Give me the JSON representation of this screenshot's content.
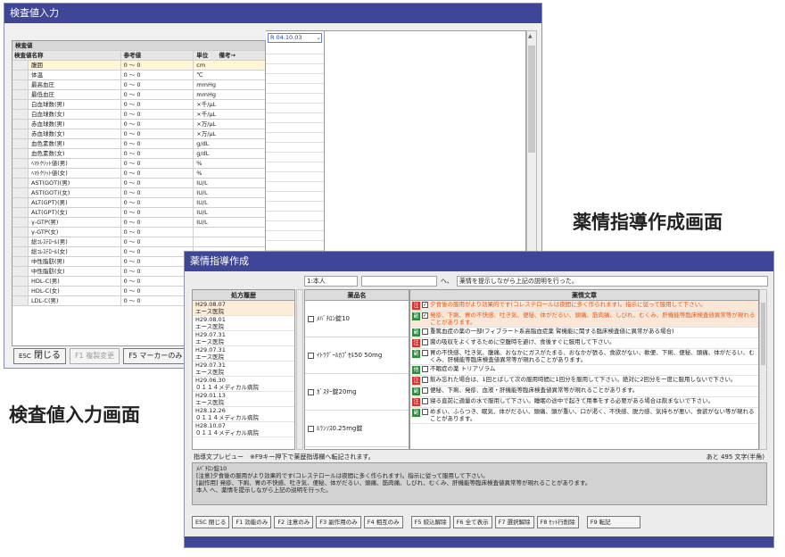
{
  "captions": {
    "lab_screen": "検査値入力画面",
    "guidance_screen": "薬情指導作成画面"
  },
  "lab_window": {
    "title": "検査値入力",
    "group_header": "検査値",
    "date_value": "R 04.10.03",
    "columns": {
      "name": "検査値名称",
      "ref": "参考値",
      "unit": "単位",
      "note": "備考→"
    },
    "rows": [
      {
        "name": "腹囲",
        "ref": "0 ～ 0",
        "unit": "cm"
      },
      {
        "name": "体温",
        "ref": "0 ～ 0",
        "unit": "℃"
      },
      {
        "name": "最高血圧",
        "ref": "0 ～ 0",
        "unit": "mmHg"
      },
      {
        "name": "最低血圧",
        "ref": "0 ～ 0",
        "unit": "mmHg"
      },
      {
        "name": "白血球数(男)",
        "ref": "0 ～ 0",
        "unit": "×千/μL"
      },
      {
        "name": "白血球数(女)",
        "ref": "0 ～ 0",
        "unit": "×千/μL"
      },
      {
        "name": "赤血球数(男)",
        "ref": "0 ～ 0",
        "unit": "×万/μL"
      },
      {
        "name": "赤血球数(女)",
        "ref": "0 ～ 0",
        "unit": "×万/μL"
      },
      {
        "name": "血色素数(男)",
        "ref": "0 ～ 0",
        "unit": "g/dL"
      },
      {
        "name": "血色素数(女)",
        "ref": "0 ～ 0",
        "unit": "g/dL"
      },
      {
        "name": "ﾍﾏﾄｸﾘｯﾄ値(男)",
        "ref": "0 ～ 0",
        "unit": "%"
      },
      {
        "name": "ﾍﾏﾄｸﾘｯﾄ値(女)",
        "ref": "0 ～ 0",
        "unit": "%"
      },
      {
        "name": "AST(GOT)(男)",
        "ref": "0 ～ 0",
        "unit": "IU/L"
      },
      {
        "name": "AST(GOT)(女)",
        "ref": "0 ～ 0",
        "unit": "IU/L"
      },
      {
        "name": "ALT(GPT)(男)",
        "ref": "0 ～ 0",
        "unit": "IU/L"
      },
      {
        "name": "ALT(GPT)(女)",
        "ref": "0 ～ 0",
        "unit": "IU/L"
      },
      {
        "name": "γ-GTP(男)",
        "ref": "0 ～ 0",
        "unit": "IU/L"
      },
      {
        "name": "γ-GTP(女)",
        "ref": "0 ～ 0",
        "unit": ""
      },
      {
        "name": "総ｺﾚｽﾃﾛｰﾙ(男)",
        "ref": "0 ～ 0",
        "unit": ""
      },
      {
        "name": "総ｺﾚｽﾃﾛｰﾙ(女)",
        "ref": "0 ～ 0",
        "unit": ""
      },
      {
        "name": "中性脂肪(男)",
        "ref": "0 ～ 0",
        "unit": ""
      },
      {
        "name": "中性脂肪(女)",
        "ref": "0 ～ 0",
        "unit": ""
      },
      {
        "name": "HDL-C(男)",
        "ref": "0 ～ 0",
        "unit": ""
      },
      {
        "name": "HDL-C(女)",
        "ref": "0 ～ 0",
        "unit": ""
      },
      {
        "name": "LDL-C(男)",
        "ref": "0 ～ 0",
        "unit": ""
      }
    ],
    "buttons": {
      "close": "閉じる",
      "close_key": "ESC",
      "f1": "F1 複製変更",
      "f5": "F5 マーカーのみ"
    }
  },
  "guidance_window": {
    "title": "薬情指導作成",
    "recipient": "1:本人",
    "to_suffix": "へ、",
    "sentence": "薬情を提示しながら上記の説明を行った。",
    "headers": {
      "history": "処方履歴",
      "drug": "薬品名",
      "message": "薬情文章"
    },
    "history": [
      {
        "date": "H29.08.07",
        "place": "エース医院"
      },
      {
        "date": "H29.08.01",
        "place": "エース医院"
      },
      {
        "date": "H29.07.31",
        "place": "エース医院"
      },
      {
        "date": "H29.07.31",
        "place": "エース医院"
      },
      {
        "date": "H29.07.31",
        "place": "エース医院"
      },
      {
        "date": "H29.06.30",
        "place": "０１１４メディカル病院"
      },
      {
        "date": "H29.01.13",
        "place": "エース医院"
      },
      {
        "date": "H28.12.26",
        "place": "０１１４メディカル病院"
      },
      {
        "date": "H28.10.07",
        "place": "０１１４メディカル病院"
      }
    ],
    "drugs": [
      {
        "name": "ﾒﾊﾞﾁﾛﾝ錠10"
      },
      {
        "name": "ｲﾄﾗｸﾞｰﾙｶﾌﾟｾﾙ50 50mg"
      },
      {
        "name": "ｶﾞｽﾀｰ錠20mg"
      },
      {
        "name": "ﾙﾗﾝｿｽ0.25mg錠"
      }
    ],
    "messages": [
      {
        "tag": "注",
        "tag_color": "#d9342b",
        "checked": true,
        "red": true,
        "text": "夕食後の服用がより効果的です(コレステロールは夜間に多く作られます)。指示に従って服用して下さい。"
      },
      {
        "tag": "副",
        "tag_color": "#2e8b3a",
        "checked": true,
        "red": true,
        "text": "発疹、下痢、胃の不快感、吐き気、便秘、体がだるい、頭痛、筋肉痛、しびれ、むくみ、肝機能等臨床検査値異常等が現れることがあります。"
      },
      {
        "tag": "副",
        "tag_color": "#2e8b3a",
        "checked": false,
        "red": false,
        "text": "重篤血症の薬の一部(フィブラート系高脂血症薬 腎機能に関する臨床検査値に異常がある場合)"
      },
      {
        "tag": "注",
        "tag_color": "#d9342b",
        "checked": false,
        "red": false,
        "text": "菌の吸収をよくするために空腹時を避け、食後すぐに服用して下さい。"
      },
      {
        "tag": "副",
        "tag_color": "#2e8b3a",
        "checked": false,
        "red": false,
        "text": "胃の不快感、吐き気、腹痛、おなかにガスがたまる、おなかが張る、食欲がない、軟便、下痢、便秘、頭痛、体がだるい、むくみ、肝機能等臨床検査値異常等が現れることがあります。"
      },
      {
        "tag": "他",
        "tag_color": "#2e8b3a",
        "checked": false,
        "red": false,
        "text": "不眠症の薬 トリアゾラム"
      },
      {
        "tag": "注",
        "tag_color": "#d9342b",
        "checked": false,
        "red": false,
        "text": "飲み忘れた場合は、1回とばして次の服用時間に1回分を服用して下さい。絶対に2回分を一度に服用しないで下さい。"
      },
      {
        "tag": "副",
        "tag_color": "#2e8b3a",
        "checked": false,
        "red": false,
        "text": "便秘、下痢、発疹、血液・肝機能等臨床検査値異常等が現れることがあります。"
      },
      {
        "tag": "注",
        "tag_color": "#d9342b",
        "checked": false,
        "red": false,
        "text": "寝る直前に適量の水で服用して下さい。睡眠の途中で起きて用事をする必要がある場合は飲まないで下さい。"
      },
      {
        "tag": "副",
        "tag_color": "#2e8b3a",
        "checked": false,
        "red": false,
        "text": "めまい、ふらつき、眠気、体がだるい、頭痛、頭が重い、口が渇く、不快感、脱力感、気持ちが悪い、食欲がない等が現れることがあります。"
      }
    ],
    "preview_label": "指導文プレビュー　※F9キー押下で薬歴指導欄へ転記されます。",
    "remaining": "あと 495 文字(半角)",
    "preview_lines": [
      "ﾒﾊﾞﾁﾛﾝ錠10",
      "[注意]夕食後の服用がより効果的です(コレステロールは夜間に多く作られます)。指示に従って服用して下さい。",
      "[副作用] 発疹、下痢、胃の不快感、吐き気、便秘、体がだるい、頭痛、筋肉痛、しびれ、むくみ、肝機能等臨床検査値異常等が現れることがあります。",
      "本人 へ、薬情を提示しながら上記の説明を行った。"
    ],
    "buttons": {
      "close": "閉じる",
      "close_key": "ESC",
      "f1": "F1 効能のみ",
      "f2": "F2 注意のみ",
      "f3": "F3 副作用のみ",
      "f4": "F4 相互のみ",
      "f5": "F5 絞込解除",
      "f6": "F6 全て表示",
      "f7": "F7 選択解除",
      "f8": "F8 ｾｯﾄ行削除",
      "f9": "F9 転記"
    }
  }
}
